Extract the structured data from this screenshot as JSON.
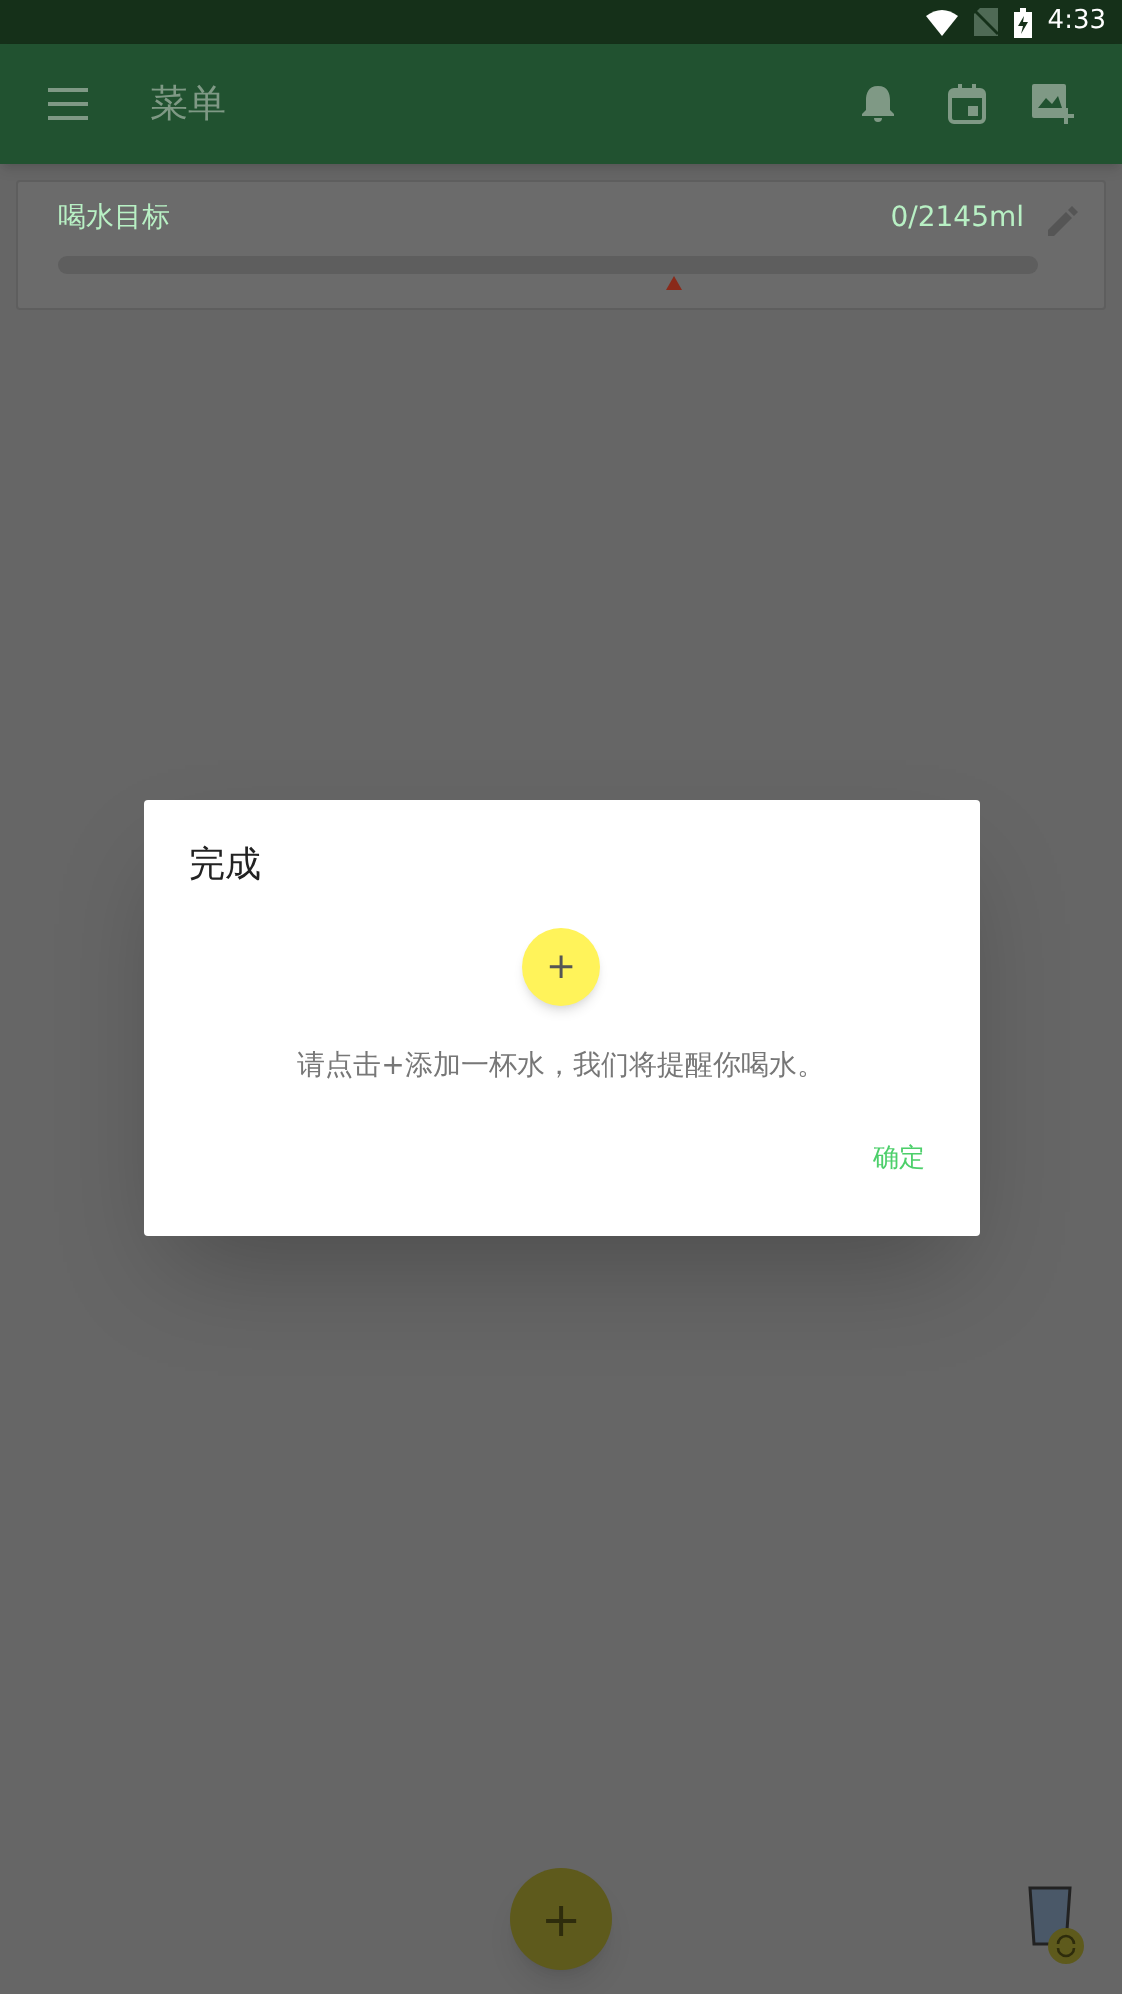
{
  "status_bar": {
    "time": "4:33"
  },
  "app_bar": {
    "title": "菜单"
  },
  "goal_card": {
    "label": "喝水目标",
    "reading": "0/2145ml",
    "level": 0
  },
  "dialog": {
    "title": "完成",
    "fab_label": "+",
    "message": "请点击+添加一杯水，我们将提醒你喝水。",
    "buttons": [
      "确定"
    ]
  },
  "fab": {
    "label": "+"
  }
}
